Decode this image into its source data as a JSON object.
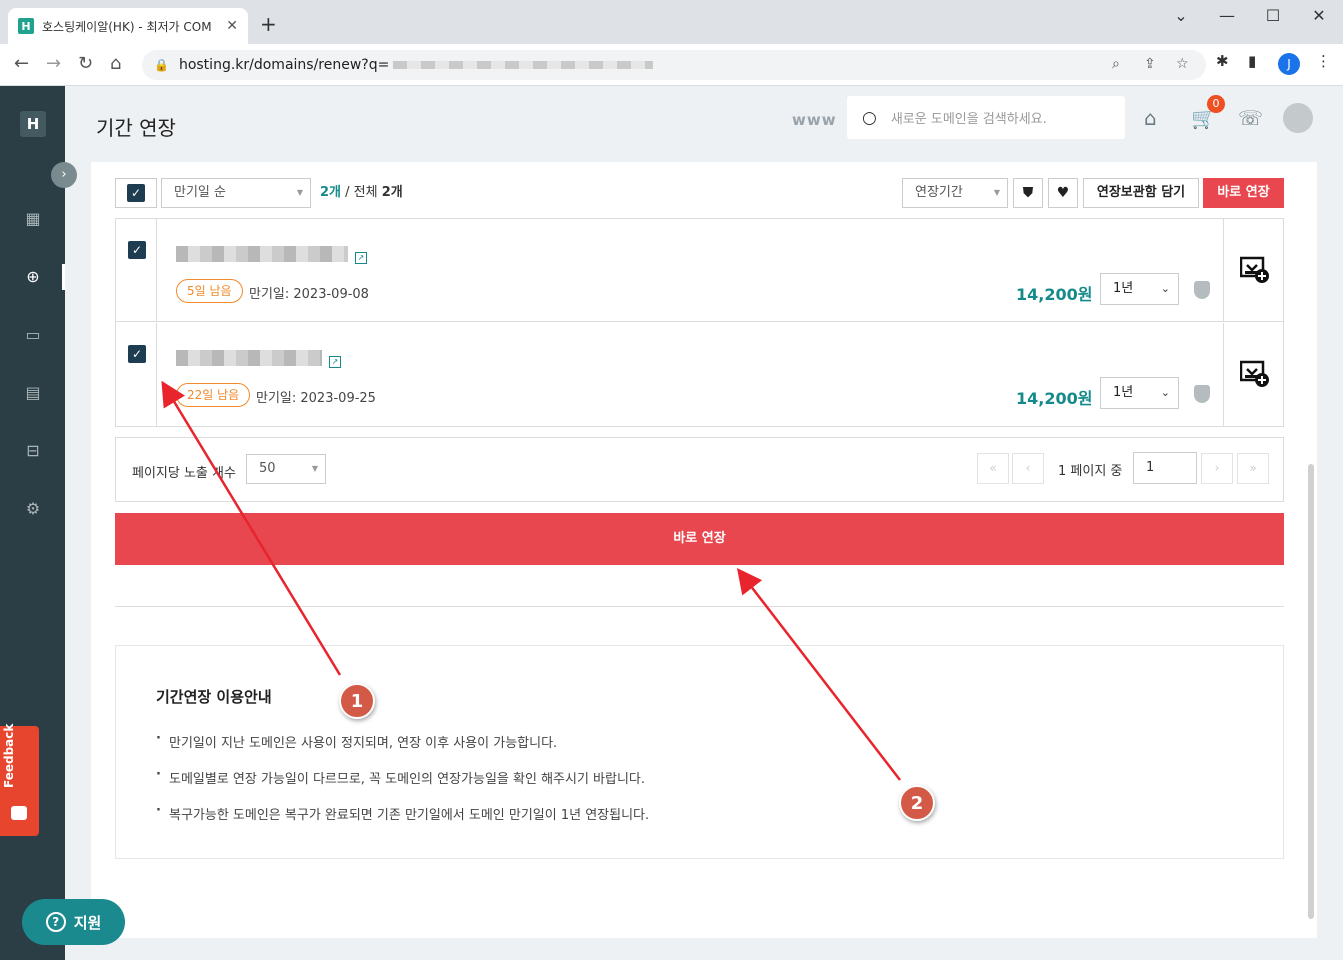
{
  "browser": {
    "tab_title": "호스팅케이알(HK) - 최저가 COM",
    "favicon_letter": "H",
    "url": "hosting.kr/domains/renew?q=",
    "profile_initial": "J"
  },
  "sidebar": {
    "logo": "H",
    "feedback_label": "Feedback",
    "icons": [
      "grid-icon",
      "globe-icon",
      "window-icon",
      "document-icon",
      "server-icon",
      "gear-icon"
    ]
  },
  "header": {
    "title": "기간 연장",
    "www_label": "www",
    "search_placeholder": "새로운 도메인을 검색하세요.",
    "cart_count": "0"
  },
  "toolbar": {
    "sort_select": "만기일 순",
    "count_selected": "2개",
    "count_separator": " / 전체 ",
    "count_total": "2개",
    "period_select": "연장기간",
    "safe_box_button": "연장보관함 담기",
    "renew_now_button": "바로 연장"
  },
  "domains": [
    {
      "days_left": "5일 남음",
      "expiry": "만기일: 2023-09-08",
      "price": "14,200원",
      "period": "1년"
    },
    {
      "days_left": "22일 남음",
      "expiry": "만기일: 2023-09-25",
      "price": "14,200원",
      "period": "1년"
    }
  ],
  "pagination": {
    "per_page_label": "페이지당 노출 개수",
    "per_page_value": "50",
    "page_text": "1 페이지 중",
    "page_input": "1"
  },
  "renew_button": "바로 연장",
  "guide": {
    "title": "기간연장 이용안내",
    "items": [
      "만기일이 지난 도메인은 사용이 정지되며, 연장 이후 사용이 가능합니다.",
      "도메일별로 연장 가능일이 다르므로, 꼭 도메인의 연장가능일을 확인 해주시기 바랍니다.",
      "복구가능한 도메인은 복구가 완료되면 기존 만기일에서 도메인 만기일이 1년 연장됩니다."
    ]
  },
  "help_button": "지원",
  "annotations": {
    "step1": "1",
    "step2": "2",
    "arrow_color": "#e8242c"
  }
}
